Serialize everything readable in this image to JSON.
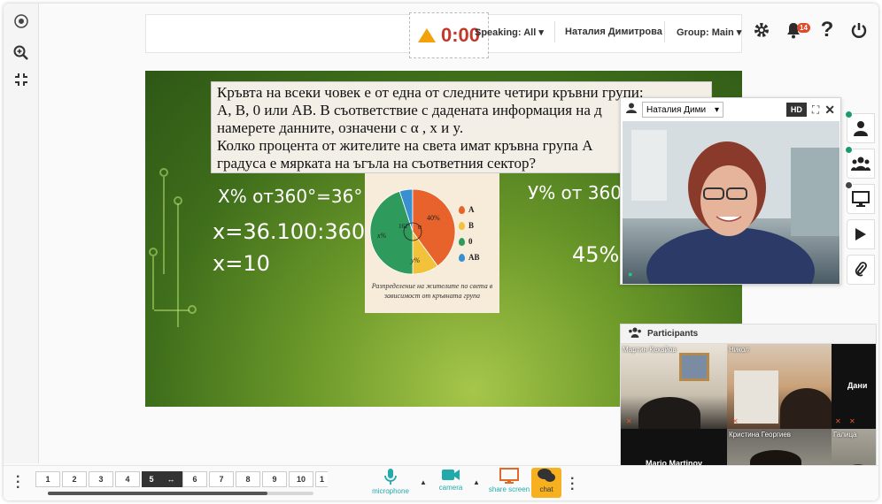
{
  "timer": {
    "value": "0:00"
  },
  "topbar": {
    "speaking": "Speaking: All",
    "presenter": "Наталия Димитрова",
    "group": "Group: Main",
    "notifications": "14"
  },
  "slide": {
    "lines": [
      "Кръвта на всеки човек е от една от следните четири кръвни групи:",
      "А, В, 0 или АВ. В съответствие с дадената информация на д",
      "намерете данните, означени с  α , x и y.",
      "Колко процента от жителите на света имат кръвна група А",
      "градуса е мярката на ъгъла на съответния сектор?"
    ],
    "hand_x_percent": "X% от360°=36°",
    "hand_x_calc": "x=36.100:360",
    "hand_x_result": "x=10",
    "hand_y_percent": "У% от 360°",
    "hand_y_result": "45%",
    "pie_caption": "Разпределение на жителите по света в зависимост от кръвната група",
    "pie_labels": {
      "forty": "40%",
      "x": "x%",
      "y": "y%",
      "alpha": "α",
      "deg": "162°"
    },
    "legend": [
      "А",
      "В",
      "0",
      "АВ"
    ]
  },
  "chart_data": {
    "type": "pie",
    "categories": [
      "А",
      "В",
      "0",
      "АВ"
    ],
    "values": [
      40,
      10,
      45,
      5
    ],
    "title": "Разпределение на жителите по света в зависимост от кръвната група",
    "colors": [
      "#e8622c",
      "#f2c23a",
      "#2e9a5c",
      "#3a8fd0"
    ]
  },
  "video": {
    "participant_select": "Наталия Дими",
    "hd": "HD"
  },
  "participants": {
    "title": "Participants",
    "tiles": [
      {
        "name": "Мартин Кехайов"
      },
      {
        "name": "Никол"
      },
      {
        "name": "Дани"
      },
      {
        "name": "Mario Martinov",
        "status": "disconnected"
      },
      {
        "name": "Кристина Георгиев"
      },
      {
        "name": "Галица"
      }
    ]
  },
  "pagination": {
    "pages": [
      "1",
      "2",
      "3",
      "4",
      "5",
      "6",
      "7",
      "8",
      "9",
      "10",
      "1"
    ],
    "active": "5",
    "swap_glyph": "↔"
  },
  "tools": {
    "microphone": "microphone",
    "camera": "camera",
    "share_screen": "share screen",
    "chat": "chat"
  },
  "icons": {
    "zoom_in": "zoom-in-icon",
    "fit": "fit-screen-icon",
    "settings": "gear-icon",
    "bell": "bell-icon",
    "help": "help-icon",
    "power": "power-icon"
  }
}
